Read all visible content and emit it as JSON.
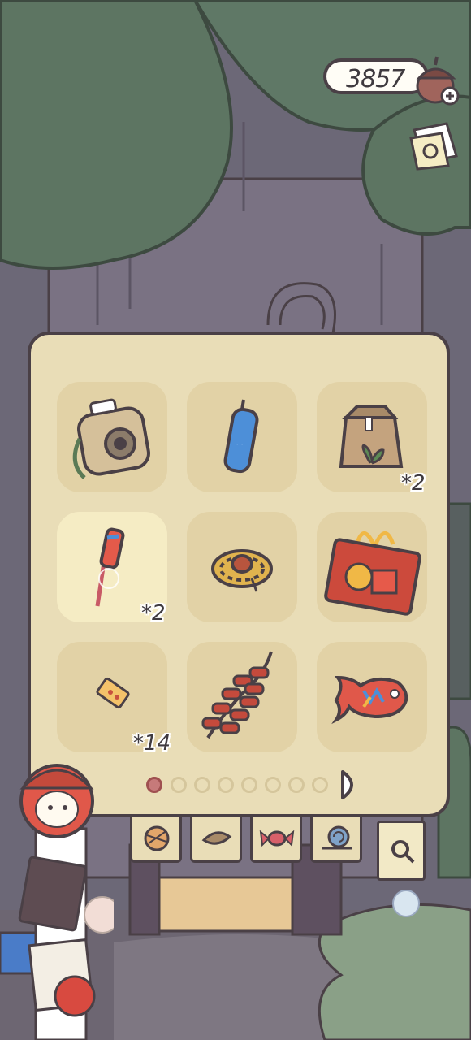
{
  "hud": {
    "currency": "3857",
    "currency_icon": "acorn-plus-icon",
    "album_icon": "photo-album-icon"
  },
  "inventory": {
    "items": [
      {
        "name": "instant-camera",
        "count": ""
      },
      {
        "name": "blue-firecracker",
        "count": ""
      },
      {
        "name": "seed-bag",
        "count": "*2"
      },
      {
        "name": "rocket-firework",
        "count": "*2"
      },
      {
        "name": "straw-hat",
        "count": ""
      },
      {
        "name": "red-gift-bag",
        "count": ""
      },
      {
        "name": "ticket",
        "count": "*14"
      },
      {
        "name": "firecracker-string",
        "count": ""
      },
      {
        "name": "fish-lantern",
        "count": ""
      }
    ],
    "page_total": 8,
    "page_current": 1
  },
  "tabs": [
    "yarn-tab",
    "leaf-tab",
    "candy-tab",
    "snail-tab",
    "search-tab"
  ],
  "colors": {
    "panel": "#e9ddb7",
    "slot": "#e2d2a6",
    "outline": "#4a4046",
    "tree": "#5d7562"
  }
}
